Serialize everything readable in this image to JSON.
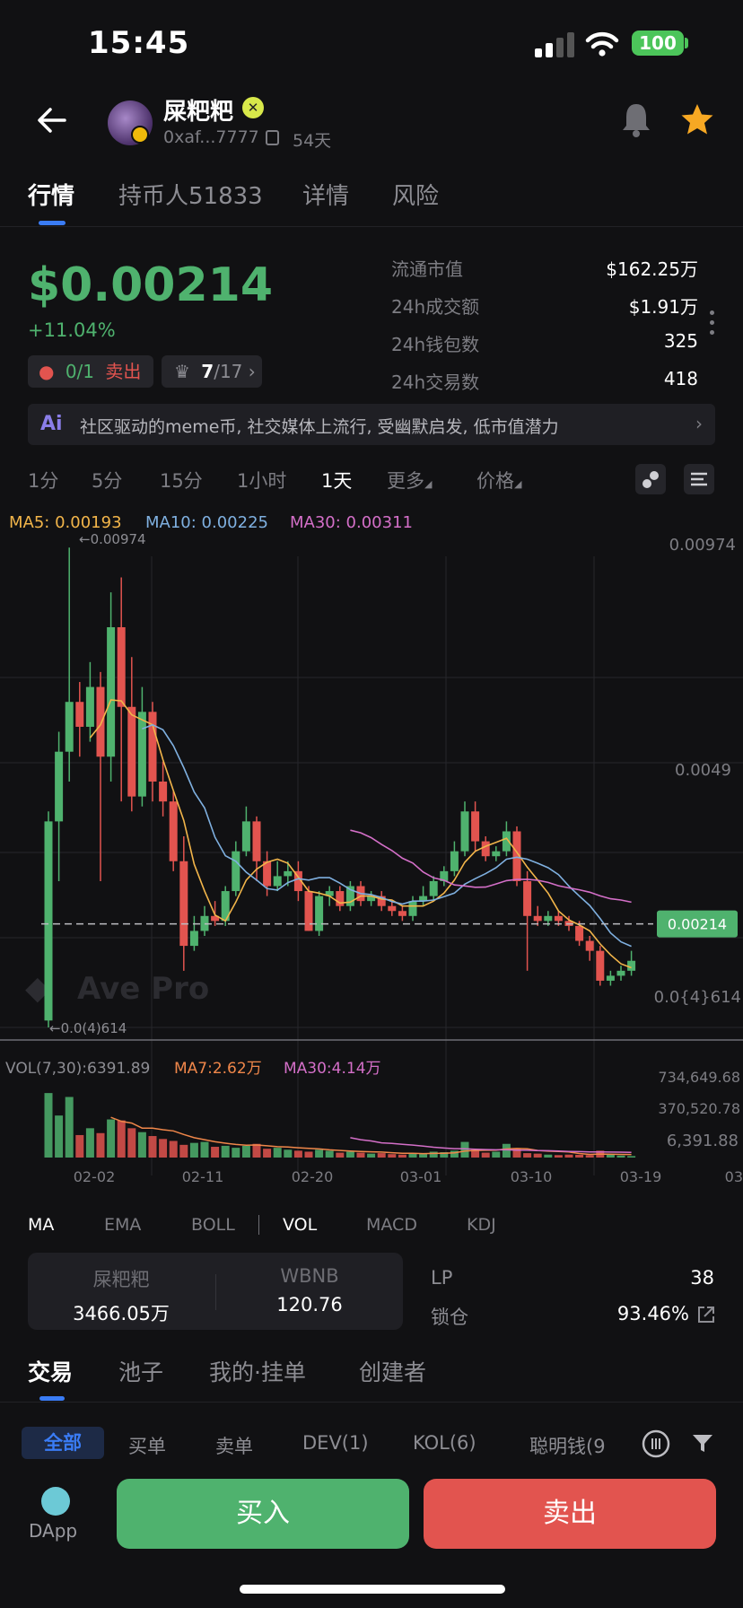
{
  "status_bar": {
    "time": "15:45",
    "battery": "100"
  },
  "header": {
    "token_name": "屎粑粑",
    "address": "0xaf...7777",
    "age": "54天"
  },
  "tabs": [
    "行情",
    "持币人51833",
    "详情",
    "风险"
  ],
  "price": {
    "value": "$0.00214",
    "change": "+11.04%",
    "pill1_count": "0/1",
    "pill1_label": "卖出",
    "pill2_bold": "7",
    "pill2_rest": "/17"
  },
  "stats": [
    {
      "label": "流通市值",
      "value": "$162.25万"
    },
    {
      "label": "24h成交额",
      "value": "$1.91万"
    },
    {
      "label": "24h钱包数",
      "value": "325"
    },
    {
      "label": "24h交易数",
      "value": "418"
    }
  ],
  "ai_summary": {
    "icon": "Ai",
    "text": "社区驱动的meme币, 社交媒体上流行, 受幽默启发, 低市值潜力"
  },
  "timeframes": [
    "1分",
    "5分",
    "15分",
    "1小时",
    "1天",
    "更多",
    "价格"
  ],
  "ma": {
    "ma5": "MA5: 0.00193",
    "ma10": "MA10: 0.00225",
    "ma30": "MA30: 0.00311"
  },
  "chart_data": {
    "type": "candlestick",
    "price_axis_labels": [
      "0.00974",
      "0.0049",
      "0.0{4}614"
    ],
    "high_marker": "←0.00974",
    "low_marker": "←0.0(4)614",
    "current_price": "0.00214",
    "watermark": "Ave Pro",
    "ylim": [
      6.14e-05,
      0.00974
    ],
    "candles": [
      [
        0.0002,
        0.0042,
        0.0044,
        6.14e-05
      ],
      [
        0.0042,
        0.0056,
        0.006,
        0.003
      ],
      [
        0.0056,
        0.0066,
        0.0097,
        0.005
      ],
      [
        0.0066,
        0.0061,
        0.007,
        0.0055
      ],
      [
        0.0061,
        0.0069,
        0.0074,
        0.0058
      ],
      [
        0.0069,
        0.0055,
        0.0072,
        0.003
      ],
      [
        0.0055,
        0.0081,
        0.0088,
        0.005
      ],
      [
        0.0081,
        0.0065,
        0.0091,
        0.0046
      ],
      [
        0.0065,
        0.0047,
        0.0075,
        0.0044
      ],
      [
        0.0047,
        0.0064,
        0.0069,
        0.0045
      ],
      [
        0.0064,
        0.005,
        0.0066,
        0.0046
      ],
      [
        0.005,
        0.0046,
        0.0054,
        0.0043
      ],
      [
        0.0046,
        0.0034,
        0.0048,
        0.0032
      ],
      [
        0.0034,
        0.0017,
        0.0039,
        0.0012
      ],
      [
        0.0017,
        0.002,
        0.0023,
        0.0016
      ],
      [
        0.002,
        0.0023,
        0.0025,
        0.0019
      ],
      [
        0.0023,
        0.0022,
        0.0026,
        0.0021
      ],
      [
        0.0022,
        0.0028,
        0.0029,
        0.0021
      ],
      [
        0.0028,
        0.0036,
        0.0038,
        0.0027
      ],
      [
        0.0036,
        0.0042,
        0.0045,
        0.0035
      ],
      [
        0.0042,
        0.0034,
        0.0043,
        0.003
      ],
      [
        0.0034,
        0.0029,
        0.0036,
        0.0027
      ],
      [
        0.0029,
        0.0031,
        0.0034,
        0.0028
      ],
      [
        0.0031,
        0.0032,
        0.0034,
        0.0029
      ],
      [
        0.0032,
        0.0028,
        0.0034,
        0.0026
      ],
      [
        0.0028,
        0.002,
        0.0029,
        0.002
      ],
      [
        0.002,
        0.0027,
        0.0028,
        0.0019
      ],
      [
        0.0027,
        0.0028,
        0.0029,
        0.0025
      ],
      [
        0.0028,
        0.0025,
        0.0029,
        0.0024
      ],
      [
        0.0025,
        0.0029,
        0.003,
        0.0024
      ],
      [
        0.0029,
        0.0026,
        0.003,
        0.0025
      ],
      [
        0.0026,
        0.0027,
        0.0028,
        0.0025
      ],
      [
        0.0027,
        0.0025,
        0.0028,
        0.0024
      ],
      [
        0.0025,
        0.0024,
        0.0026,
        0.0023
      ],
      [
        0.0024,
        0.0023,
        0.0025,
        0.0022
      ],
      [
        0.0023,
        0.0026,
        0.0027,
        0.0022
      ],
      [
        0.0026,
        0.0027,
        0.0029,
        0.0025
      ],
      [
        0.0027,
        0.003,
        0.0031,
        0.0026
      ],
      [
        0.003,
        0.0032,
        0.0033,
        0.0029
      ],
      [
        0.0032,
        0.0036,
        0.0038,
        0.0031
      ],
      [
        0.0036,
        0.0044,
        0.0046,
        0.0035
      ],
      [
        0.0044,
        0.0038,
        0.0046,
        0.0036
      ],
      [
        0.0038,
        0.0035,
        0.0039,
        0.0034
      ],
      [
        0.0035,
        0.0036,
        0.0037,
        0.0034
      ],
      [
        0.0036,
        0.004,
        0.0042,
        0.0035
      ],
      [
        0.004,
        0.003,
        0.0041,
        0.0029
      ],
      [
        0.003,
        0.0023,
        0.0032,
        0.0012
      ],
      [
        0.0023,
        0.0022,
        0.0025,
        0.0021
      ],
      [
        0.0022,
        0.0023,
        0.0024,
        0.0021
      ],
      [
        0.0023,
        0.0022,
        0.0024,
        0.0021
      ],
      [
        0.0022,
        0.0021,
        0.0023,
        0.002
      ],
      [
        0.0021,
        0.0018,
        0.0022,
        0.0017
      ],
      [
        0.0018,
        0.0016,
        0.0019,
        0.0014
      ],
      [
        0.0016,
        0.001,
        0.0017,
        0.0009
      ],
      [
        0.001,
        0.0011,
        0.0012,
        0.0009
      ],
      [
        0.0011,
        0.0012,
        0.0013,
        0.001
      ],
      [
        0.0012,
        0.0014,
        0.0016,
        0.0011
      ]
    ],
    "volume_axis_labels": [
      "734,649.68",
      "370,520.78",
      "6,391.88"
    ],
    "volume": [
      660000,
      430000,
      620000,
      230000,
      300000,
      250000,
      390000,
      380000,
      300000,
      260000,
      220000,
      190000,
      170000,
      130000,
      150000,
      160000,
      110000,
      120000,
      100000,
      120000,
      140000,
      90000,
      100000,
      80000,
      70000,
      60000,
      80000,
      70000,
      50000,
      60000,
      50000,
      40000,
      45000,
      35000,
      30000,
      40000,
      45000,
      60000,
      55000,
      70000,
      160000,
      80000,
      50000,
      60000,
      140000,
      90000,
      45000,
      40000,
      30000,
      25000,
      30000,
      28000,
      25000,
      70000,
      30000,
      20000,
      15000
    ],
    "vol_header": {
      "label": "VOL(7,30):6391.89",
      "ma7": "MA7:2.62万",
      "ma30": "MA30:4.14万"
    },
    "x_labels": [
      "02-02",
      "02-11",
      "02-20",
      "03-01",
      "03-10",
      "03-19",
      "03"
    ],
    "colors": {
      "up": "#4fb26e",
      "down": "#e2544f",
      "ma5": "#f2b54a",
      "ma10": "#7fb0e0",
      "ma30": "#d46fc8"
    }
  },
  "indicators": [
    "MA",
    "EMA",
    "BOLL",
    "VOL",
    "MACD",
    "KDJ"
  ],
  "liquidity": {
    "token_a_label": "屎粑粑",
    "token_a_value": "3466.05万",
    "token_b_label": "WBNB",
    "token_b_value": "120.76",
    "lp_label": "LP",
    "lp_value": "38",
    "lock_label": "锁仓",
    "lock_value": "93.46%"
  },
  "tabs2": [
    "交易",
    "池子",
    "我的·挂单",
    "创建者"
  ],
  "filters": [
    "全部",
    "买单",
    "卖单",
    "DEV(1)",
    "KOL(6)",
    "聪明钱(9"
  ],
  "bottom": {
    "dapp": "DApp",
    "buy": "买入",
    "sell": "卖出"
  }
}
